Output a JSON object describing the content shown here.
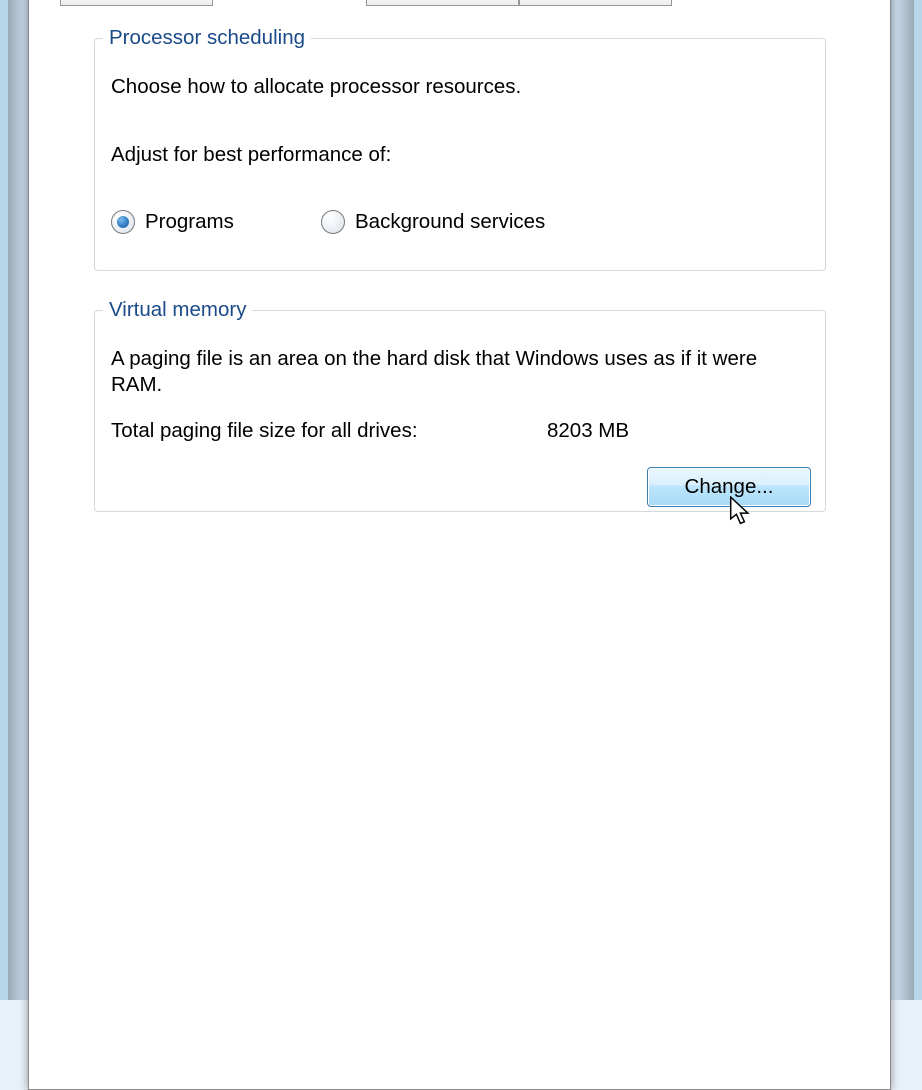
{
  "processor_scheduling": {
    "legend": "Processor scheduling",
    "desc": "Choose how to allocate processor resources.",
    "subhead": "Adjust for best performance of:",
    "option_programs": "Programs",
    "option_background": "Background services",
    "selected": "Programs"
  },
  "virtual_memory": {
    "legend": "Virtual memory",
    "desc": "A paging file is an area on the hard disk that Windows uses as if it were RAM.",
    "total_label": "Total paging file size for all drives:",
    "total_value": "8203 MB",
    "change_label": "Change..."
  }
}
